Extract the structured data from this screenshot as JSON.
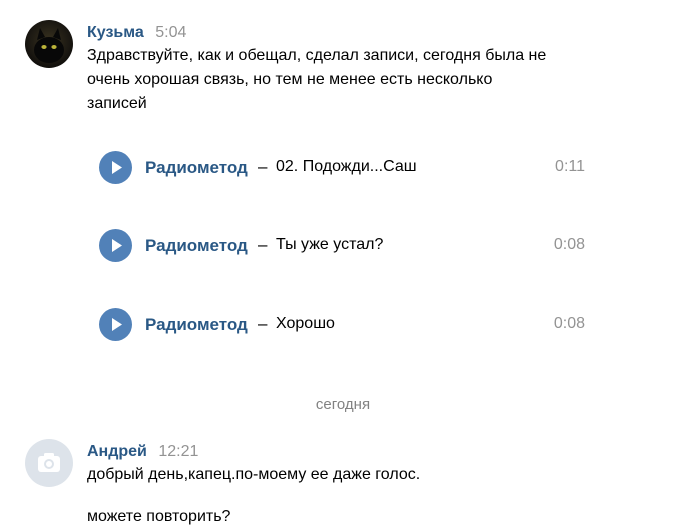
{
  "messages": [
    {
      "author": "Кузьма",
      "time": "5:04",
      "text_lines": [
        "Здравствуйте, как и обещал, сделал записи, сегодня была не",
        "очень хорошая связь, но тем не менее есть несколько",
        "записей"
      ],
      "attachments": [
        {
          "artist": "Радиометод",
          "separator": "–",
          "title": "02. Подожди...Саш",
          "duration": "0:11"
        },
        {
          "artist": "Радиометод",
          "separator": "–",
          "title": "Ты уже устал?",
          "duration": "0:08"
        },
        {
          "artist": "Радиометод",
          "separator": "–",
          "title": "Хорошо",
          "duration": "0:08"
        }
      ]
    },
    {
      "author": "Андрей",
      "time": "12:21",
      "text_lines": [
        "добрый день,капец.по-моему ее даже голос.",
        "можете повторить?"
      ]
    }
  ],
  "date_separator": "сегодня",
  "icons": {
    "play": "play-icon",
    "camera": "camera-icon"
  },
  "colors": {
    "author_link": "#2a5885",
    "play_button": "#5181b8",
    "timestamp": "#939393"
  }
}
